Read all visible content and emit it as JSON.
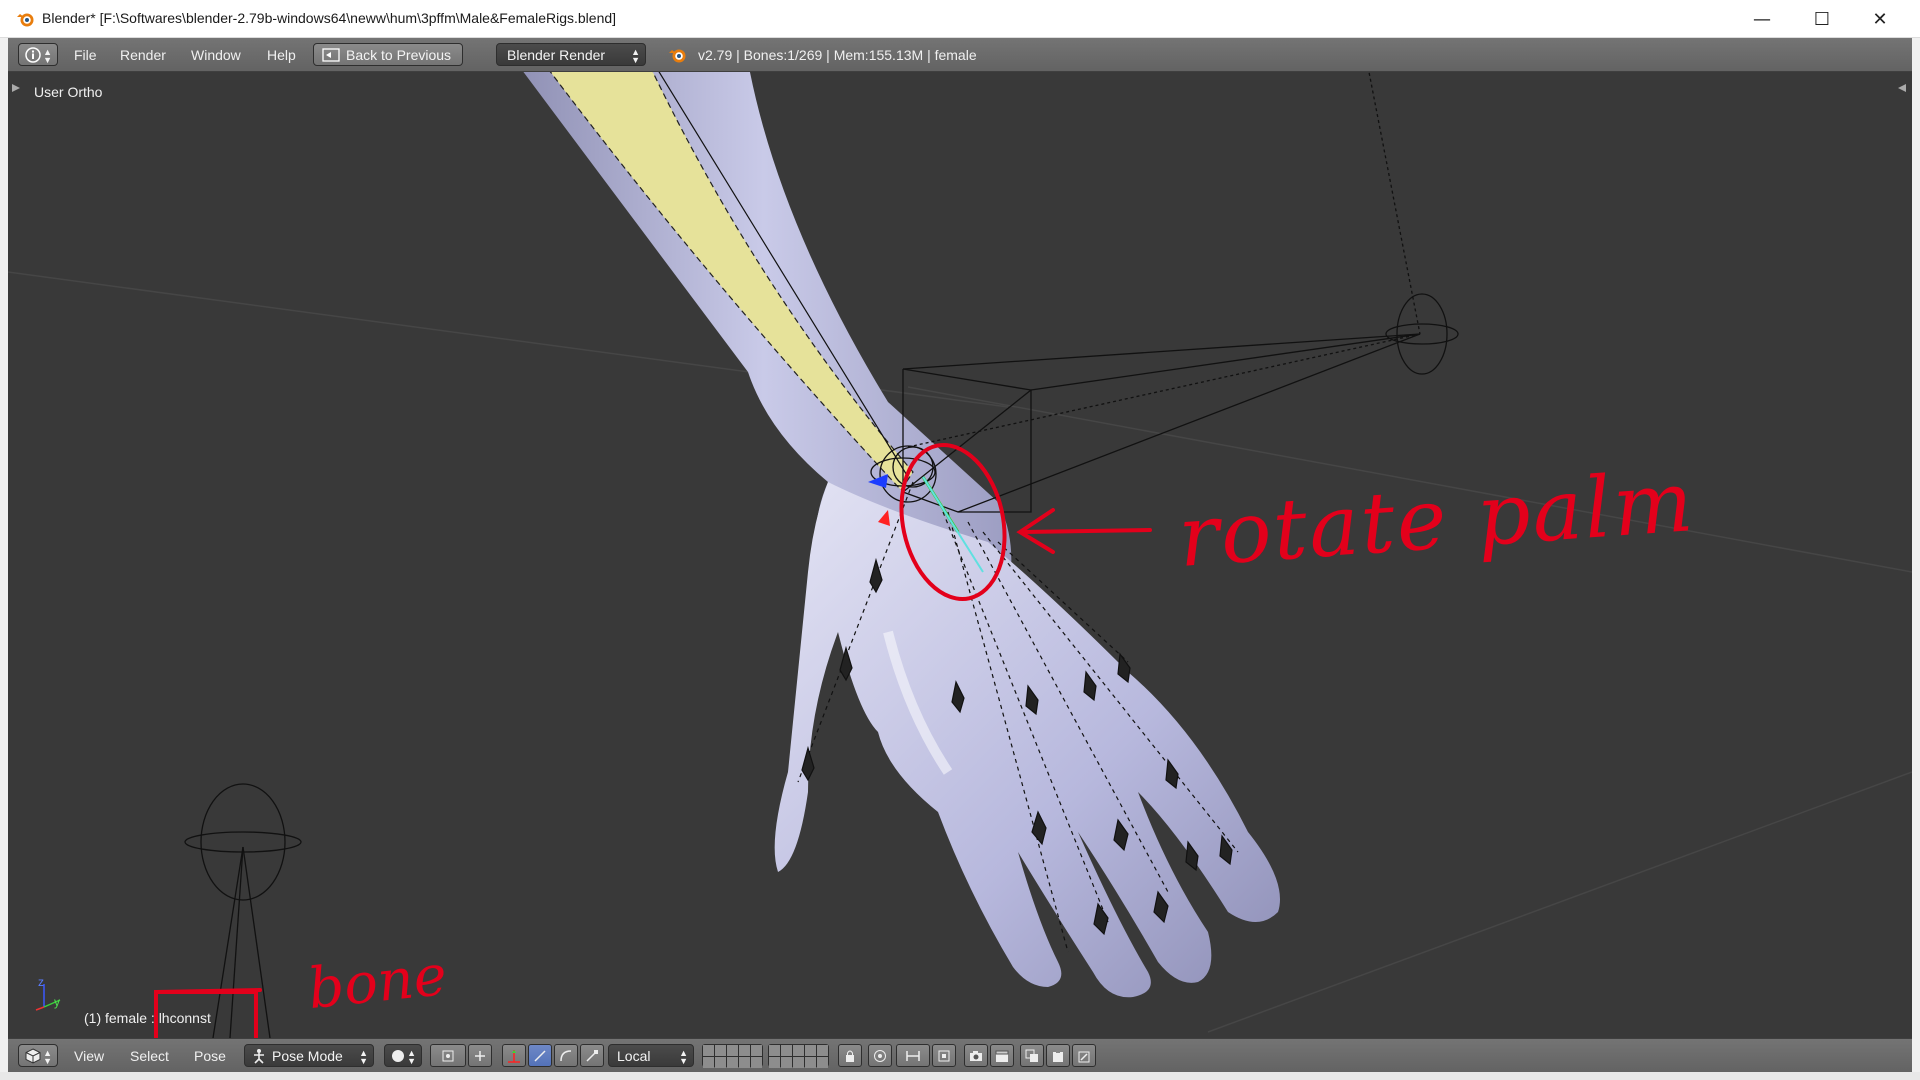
{
  "window": {
    "title": "Blender* [F:\\Softwares\\blender-2.79b-windows64\\neww\\hum\\3pffm\\Male&FemaleRigs.blend]",
    "minimize": "—",
    "maximize": "☐",
    "close": "✕"
  },
  "info_header": {
    "menus": [
      "File",
      "Render",
      "Window",
      "Help"
    ],
    "back_button": "Back to Previous",
    "render_engine": "Blender Render",
    "stats": "v2.79 | Bones:1/269  | Mem:155.13M | female"
  },
  "viewport": {
    "view_label": "User Ortho",
    "object_info": "(1) female : lhconnst",
    "axis_labels": [
      "z",
      "y"
    ]
  },
  "annotations": {
    "rotate_text": "rotate  palm",
    "bone_text": "bone"
  },
  "view3d_header": {
    "menus": [
      "View",
      "Select",
      "Pose"
    ],
    "mode": "Pose Mode",
    "orientation": "Local"
  },
  "colors": {
    "annotation": "#e3001b",
    "viewport_bg": "#393939",
    "header_bg": "#6b6b6b",
    "mesh": "#b8b9e0",
    "bone_selected": "#e6e29a"
  }
}
